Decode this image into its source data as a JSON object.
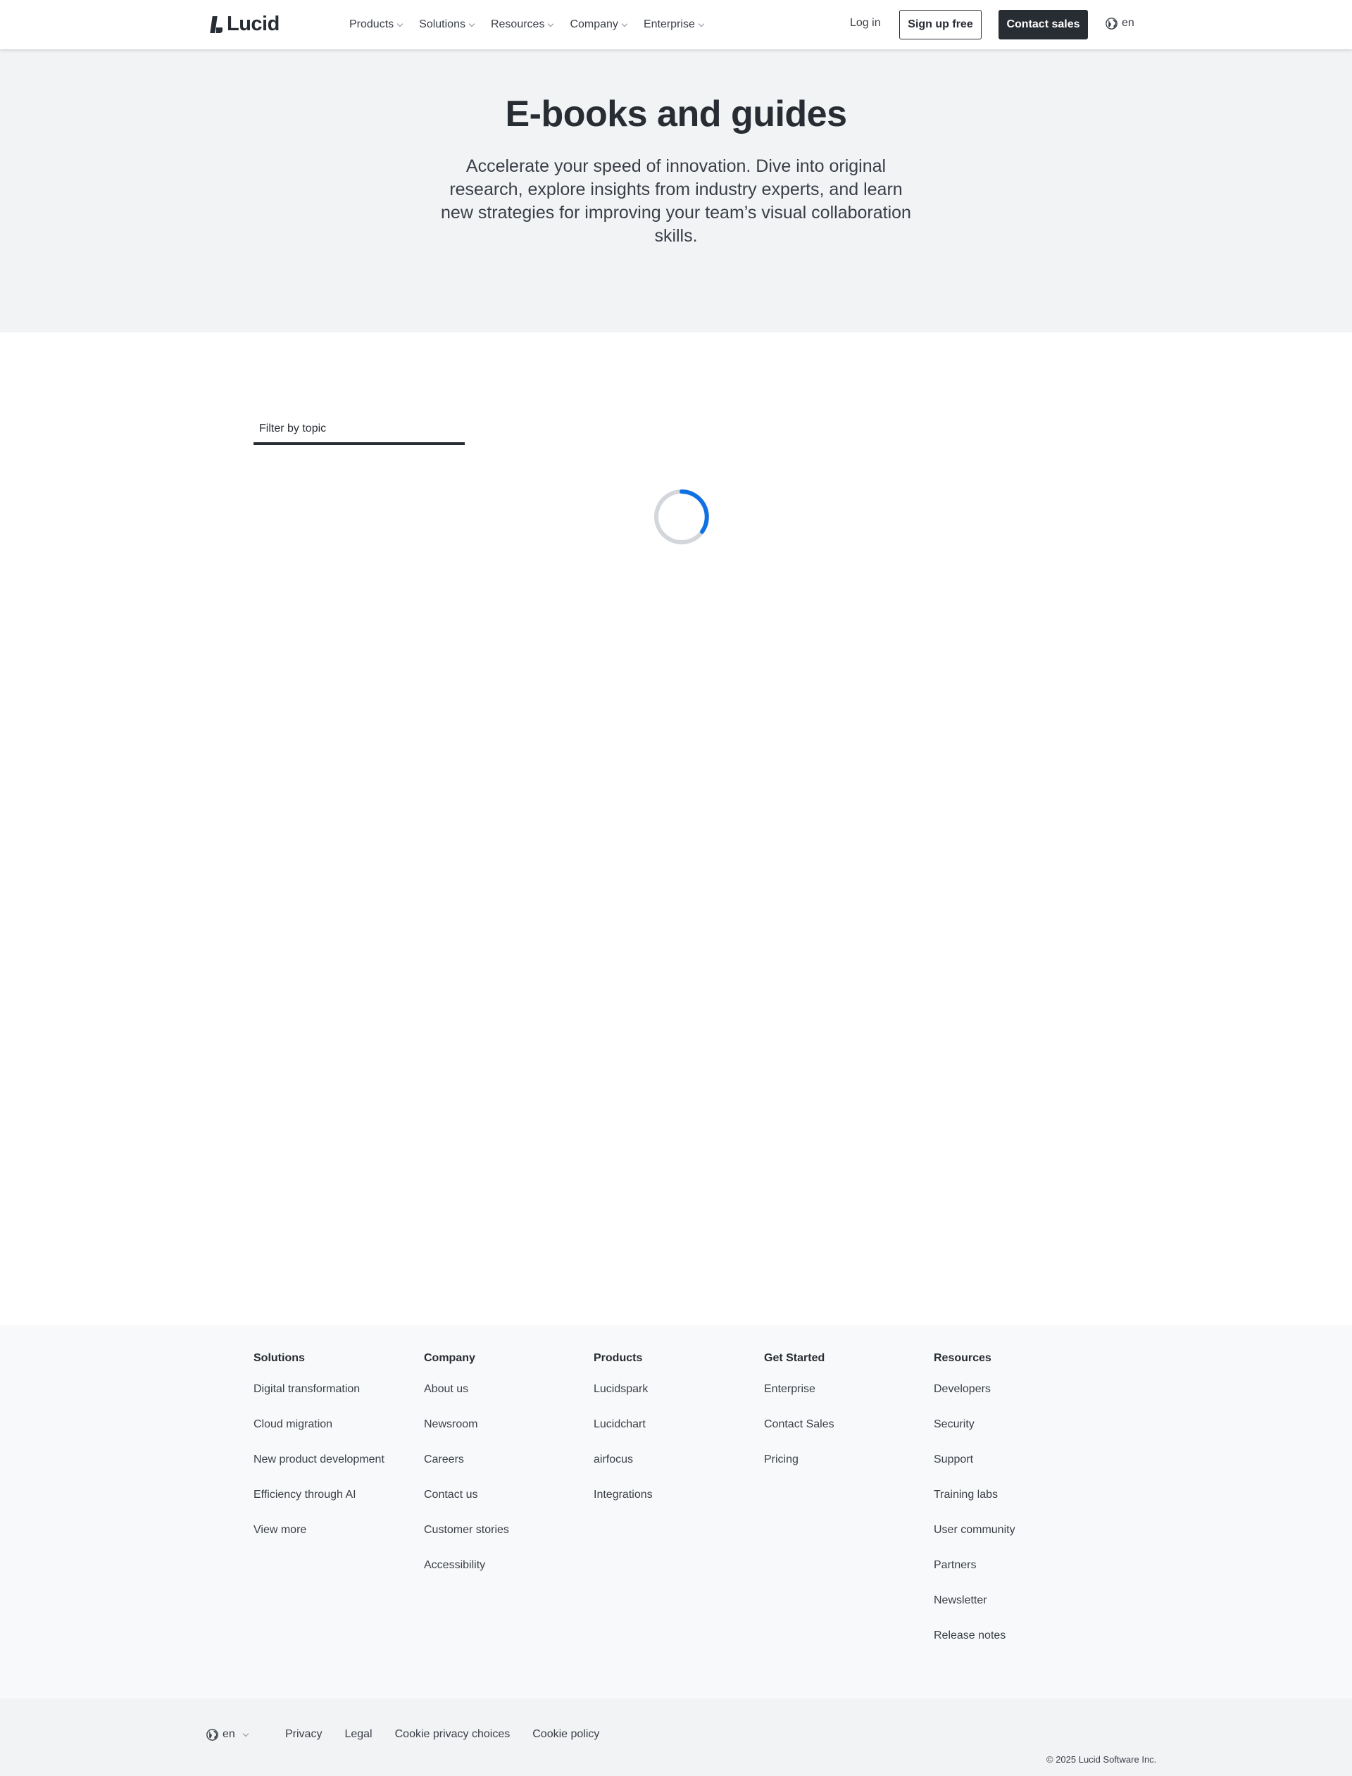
{
  "header": {
    "logo_text": "Lucid",
    "nav": [
      {
        "label": "Products"
      },
      {
        "label": "Solutions"
      },
      {
        "label": "Resources"
      },
      {
        "label": "Company"
      },
      {
        "label": "Enterprise"
      }
    ],
    "login_label": "Log in",
    "signup_label": "Sign up free",
    "contact_label": "Contact sales",
    "lang_label": "en"
  },
  "hero": {
    "title": "E-books and guides",
    "text": "Accelerate your speed of innovation. Dive into original research, explore insights from industry experts, and learn new strategies for improving your team’s visual collaboration skills."
  },
  "filter": {
    "label": "Filter by topic"
  },
  "colors": {
    "accent": "#1071e5",
    "dark": "#282c33",
    "hero_bg": "#f2f3f5",
    "spinner_track": "#d3d6db"
  },
  "footer": {
    "columns": [
      {
        "title": "Solutions",
        "links": [
          "Digital transformation",
          "Cloud migration",
          "New product development",
          "Efficiency through AI",
          "View more"
        ]
      },
      {
        "title": "Company",
        "links": [
          "About us",
          "Newsroom",
          "Careers",
          "Contact us",
          "Customer stories",
          "Accessibility"
        ]
      },
      {
        "title": "Products",
        "links": [
          "Lucidspark",
          "Lucidchart",
          "airfocus",
          "Integrations"
        ]
      },
      {
        "title": "Get Started",
        "links": [
          "Enterprise",
          "Contact Sales",
          "Pricing"
        ]
      },
      {
        "title": "Resources",
        "links": [
          "Developers",
          "Security",
          "Support",
          "Training labs",
          "User community",
          "Partners",
          "Newsletter",
          "Release notes"
        ]
      }
    ],
    "lang_label": "en",
    "legal": [
      "Privacy",
      "Legal",
      "Cookie privacy choices",
      "Cookie policy"
    ],
    "copyright": "© 2025 Lucid Software Inc."
  }
}
